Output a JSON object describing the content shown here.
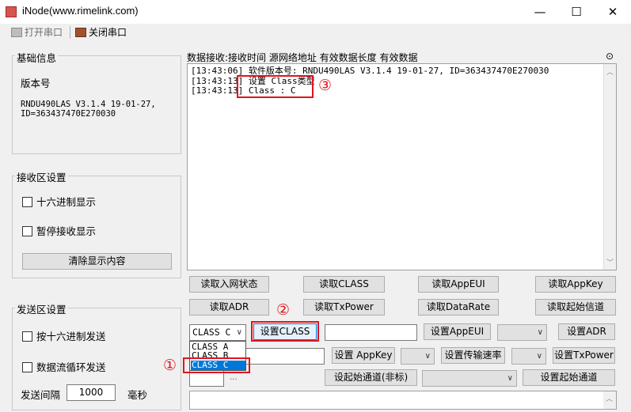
{
  "window": {
    "title": "iNode(www.rimelink.com)",
    "minimize": "—",
    "maximize": "☐",
    "close": "✕"
  },
  "toolbar": {
    "open_label": "打开串口",
    "close_label": "关闭串口"
  },
  "basic_info": {
    "title": "基础信息",
    "version_label": "版本号",
    "version_value_1": "RNDU490LAS V3.1.4 19-01-27,",
    "version_value_2": "ID=363437470E270030"
  },
  "recv_settings": {
    "title": "接收区设置",
    "hex_display": "十六进制显示",
    "pause_display": "暂停接收显示",
    "clear_button": "清除显示内容"
  },
  "send_settings": {
    "title": "发送区设置",
    "hex_send": "按十六进制发送",
    "loop_send": "数据流循环发送",
    "interval_label": "发送间隔",
    "interval_value": "1000",
    "interval_unit": "毫秒"
  },
  "receive": {
    "header": "数据接收:接收时间 源网络地址 有效数据长度 有效数据",
    "lines": [
      "[13:43:06] 软件版本号: RNDU490LAS V3.1.4 19-01-27, ID=363437470E270030",
      "[13:43:13] 设置 Class类型",
      "[13:43:13] Class : C"
    ]
  },
  "buttons_row1": [
    "读取入网状态",
    "读取CLASS",
    "读取AppEUI",
    "读取AppKey"
  ],
  "buttons_row2": [
    "读取ADR",
    "读取TxPower",
    "读取DataRate",
    "读取起始信道"
  ],
  "row3": {
    "class_select": "CLASS C",
    "set_class": "设置CLASS",
    "set_appeui": "设置AppEUI",
    "set_adr": "设置ADR"
  },
  "row4": {
    "set_appkey": "设置 AppKey",
    "set_rate": "设置传输速率",
    "set_txpower": "设置TxPower"
  },
  "row5": {
    "set_start_channel_nonstd": "设起始通道(非标)",
    "set_start_channel": "设置起始通道",
    "ellipsis": "..."
  },
  "class_options": [
    "CLASS A",
    "CLASS B",
    "CLASS C"
  ],
  "annotations": {
    "n1": "①",
    "n2": "②",
    "n3": "③",
    "accent_color": "#e0141e"
  }
}
